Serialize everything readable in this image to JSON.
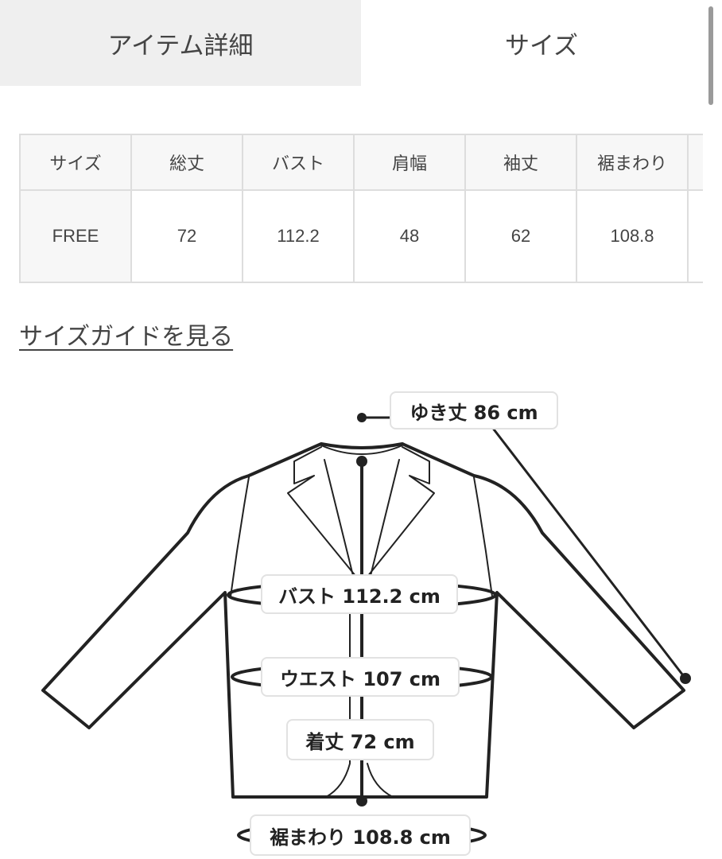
{
  "tabs": [
    {
      "label": "アイテム詳細",
      "active": false
    },
    {
      "label": "サイズ",
      "active": true
    }
  ],
  "size_table": {
    "headers": [
      "サイズ",
      "総丈",
      "バスト",
      "肩幅",
      "袖丈",
      "裾まわり",
      ""
    ],
    "rows": [
      [
        "FREE",
        "72",
        "112.2",
        "48",
        "62",
        "108.8",
        ""
      ]
    ]
  },
  "size_guide_link": "サイズガイドを見る",
  "diagram": {
    "labels": {
      "yuki": "ゆき丈 86 cm",
      "bust": "バスト 112.2 cm",
      "waist": "ウエスト 107 cm",
      "length": "着丈 72 cm",
      "hem": "裾まわり 108.8 cm"
    }
  },
  "colors": {
    "tab_inactive_bg": "#efefef",
    "table_border": "#dddddd",
    "header_bg": "#f7f7f7",
    "outline": "#222222"
  }
}
